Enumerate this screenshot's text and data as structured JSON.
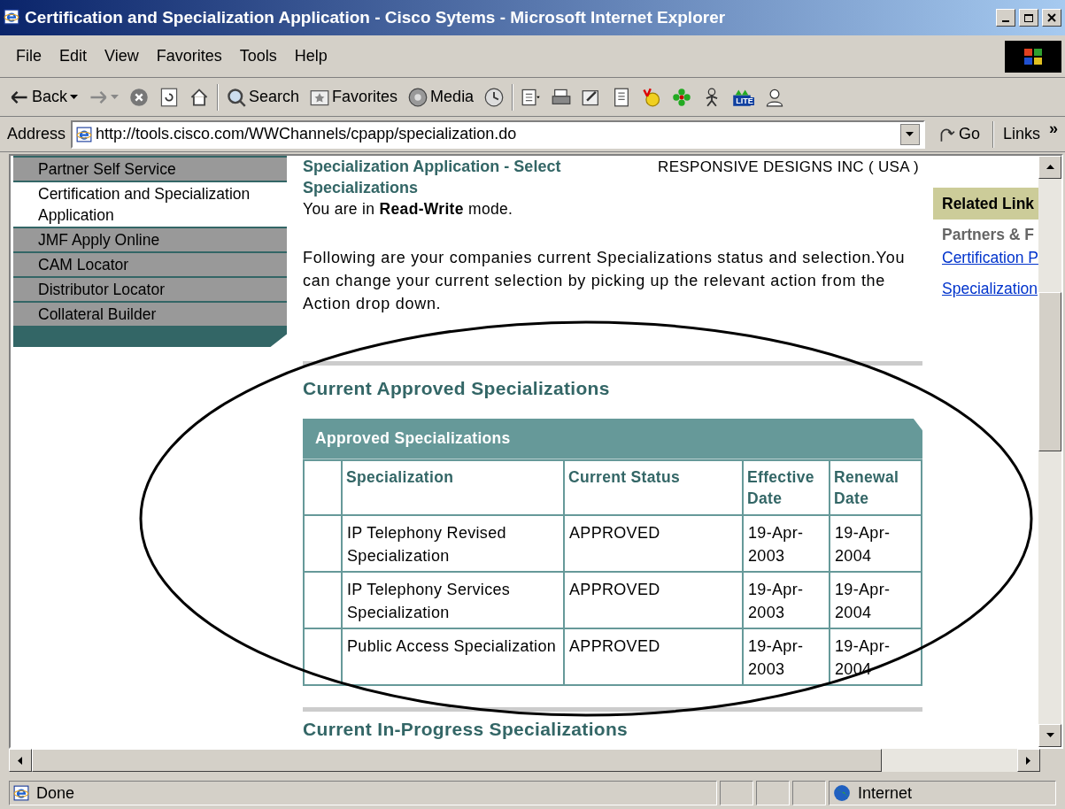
{
  "window": {
    "title": "Certification and Specialization Application - Cisco Sytems - Microsoft Internet Explorer"
  },
  "menu": [
    {
      "label": "File"
    },
    {
      "label": "Edit"
    },
    {
      "label": "View"
    },
    {
      "label": "Favorites"
    },
    {
      "label": "Tools"
    },
    {
      "label": "Help"
    }
  ],
  "toolbar": [
    {
      "kind": "back",
      "label": "Back"
    },
    {
      "kind": "forward"
    },
    {
      "kind": "stop"
    },
    {
      "kind": "refresh"
    },
    {
      "kind": "home"
    },
    {
      "kind": "search",
      "label": "Search"
    },
    {
      "kind": "favorites",
      "label": "Favorites"
    },
    {
      "kind": "media",
      "label": "Media"
    },
    {
      "kind": "history"
    },
    {
      "kind": "mail"
    },
    {
      "kind": "print"
    },
    {
      "kind": "edit"
    },
    {
      "kind": "discuss"
    },
    {
      "kind": "messenger"
    },
    {
      "kind": "flower"
    },
    {
      "kind": "person"
    },
    {
      "kind": "lite",
      "label": "LITE"
    },
    {
      "kind": "user"
    }
  ],
  "address_bar": {
    "label": "Address",
    "value": "http://tools.cisco.com/WWChannels/cpapp/specialization.do",
    "go": "Go",
    "links": "Links",
    "more": "»"
  },
  "sidebar": {
    "items": [
      {
        "label": "Partner Self Service",
        "selected": false
      },
      {
        "label": "Certification and Specialization Application",
        "selected": true
      },
      {
        "label": "JMF Apply Online",
        "selected": false
      },
      {
        "label": "CAM Locator",
        "selected": false
      },
      {
        "label": "Distributor Locator",
        "selected": false
      },
      {
        "label": "Collateral Builder",
        "selected": false
      }
    ]
  },
  "page": {
    "title": "Specialization Application - Select Specializations",
    "company": "RESPONSIVE DESIGNS INC ( USA )",
    "mode_note": "You are in **Read-Write** mode.",
    "intro": "Following are your companies current Specializations status and selection.You can change your current selection by picking up the relevant action from the Action drop down.",
    "section_title": "Current Approved Specializations",
    "table": {
      "caption": "Approved Specializations",
      "columns": [
        "Specialization",
        "Current Status",
        "Effective Date",
        "Renewal Date"
      ],
      "rows": [
        [
          "IP Telephony Revised Specialization",
          "APPROVED",
          "19-Apr-2003",
          "19-Apr-2004"
        ],
        [
          "IP Telephony Services Specialization",
          "APPROVED",
          "19-Apr-2003",
          "19-Apr-2004"
        ],
        [
          "Public Access Specialization",
          "APPROVED",
          "19-Apr-2003",
          "19-Apr-2004"
        ]
      ]
    },
    "next_section_title": "Current In-Progress Specializations"
  },
  "related_links": {
    "title": "Related Link",
    "group": "Partners & F",
    "links": [
      "Certification P",
      "Specialization"
    ]
  },
  "annotation": {
    "kind": "ellipse"
  },
  "status_bar": {
    "text": "Done",
    "zone": "Internet"
  }
}
